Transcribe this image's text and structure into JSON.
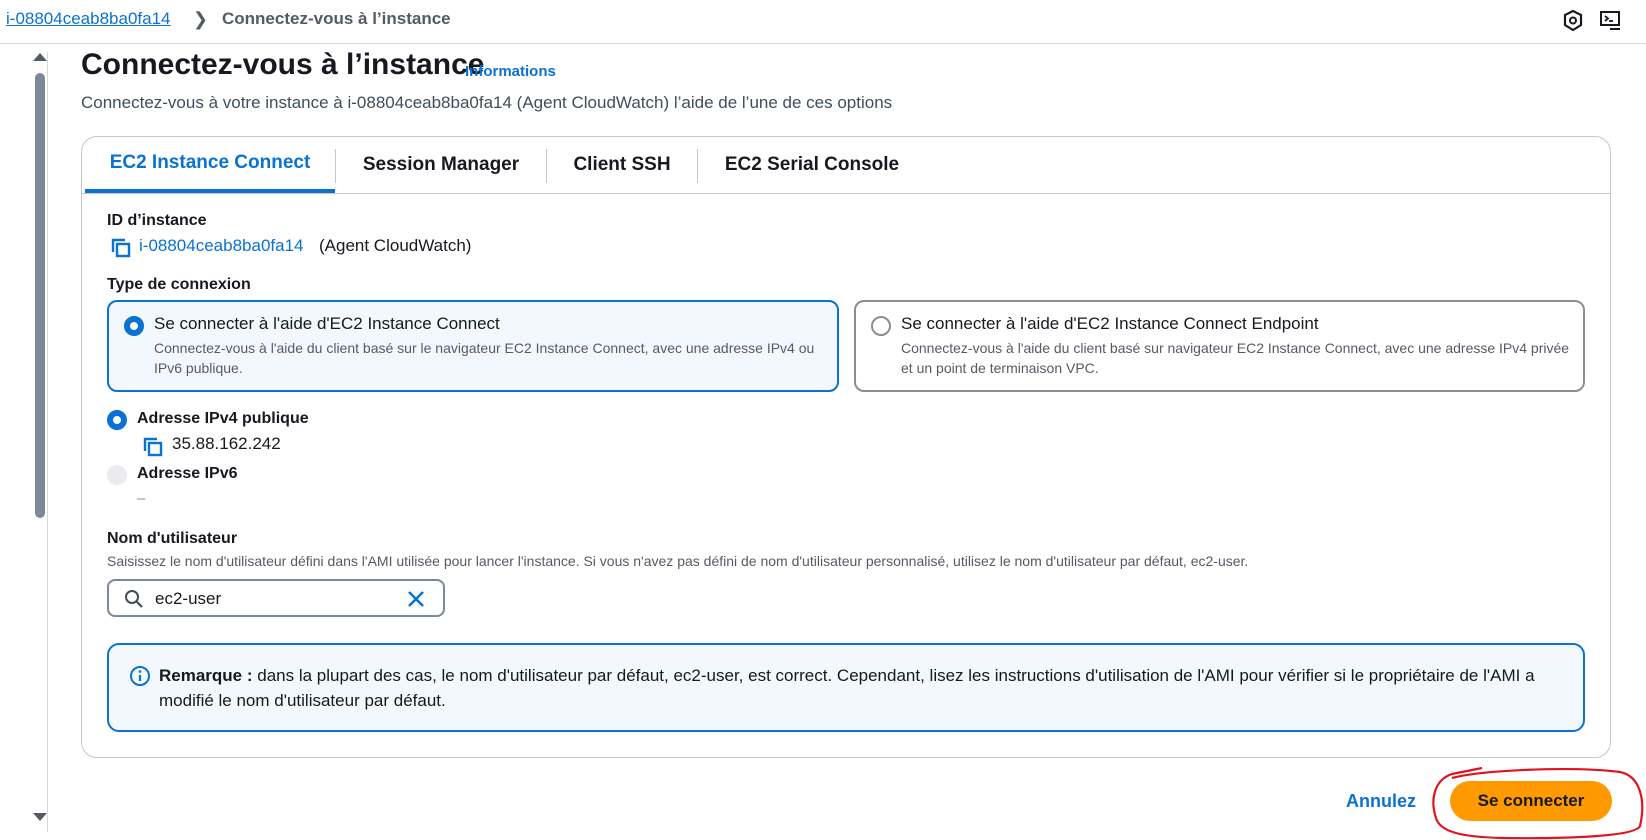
{
  "breadcrumb": {
    "instance_link": "i-08804ceab8ba0fa14",
    "current": "Connectez-vous à l’instance"
  },
  "header": {
    "title": "Connectez-vous à l’instance",
    "info_link": "Informations",
    "subtitle": "Connectez-vous à votre instance à i-08804ceab8ba0fa14 (Agent CloudWatch) l’aide de l’une de ces options"
  },
  "tabs": [
    {
      "label": "EC2 Instance Connect",
      "active": true
    },
    {
      "label": "Session Manager",
      "active": false
    },
    {
      "label": "Client SSH",
      "active": false
    },
    {
      "label": "EC2 Serial Console",
      "active": false
    }
  ],
  "instance": {
    "label": "ID d’instance",
    "id": "i-08804ceab8ba0fa14",
    "name": "(Agent CloudWatch)"
  },
  "connection_type": {
    "label": "Type de connexion",
    "options": [
      {
        "title": "Se connecter à l'aide d'EC2 Instance Connect",
        "description": "Connectez-vous à l'aide du client basé sur le navigateur EC2 Instance Connect, avec une adresse IPv4 ou IPv6 publique.",
        "selected": true
      },
      {
        "title": "Se connecter à l'aide d'EC2 Instance Connect Endpoint",
        "description": "Connectez-vous à l'aide du client basé sur navigateur EC2 Instance Connect, avec une adresse IPv4 privée et un point de terminaison VPC.",
        "selected": false
      }
    ]
  },
  "address": {
    "ipv4_label": "Adresse IPv4 publique",
    "ipv4_value": "35.88.162.242",
    "ipv6_label": "Adresse IPv6",
    "ipv6_value": "–"
  },
  "username": {
    "label": "Nom d'utilisateur",
    "hint": "Saisissez le nom d'utilisateur défini dans l'AMI utilisée pour lancer l'instance. Si vous n'avez pas défini de nom d'utilisateur personnalisé, utilisez le nom d'utilisateur par défaut, ec2-user.",
    "value": "ec2-user"
  },
  "note": {
    "strong": "Remarque :",
    "text": " dans la plupart des cas, le nom d'utilisateur par défaut, ec2-user, est correct. Cependant, lisez les instructions d'utilisation de l'AMI pour vérifier si le propriétaire de l'AMI a modifié le nom d'utilisateur par défaut."
  },
  "footer": {
    "cancel_label": "Annulez",
    "connect_label": "Se connecter"
  },
  "colors": {
    "accent": "#0972d3",
    "primary_button": "#ff9900",
    "annotation": "#e0141e"
  }
}
